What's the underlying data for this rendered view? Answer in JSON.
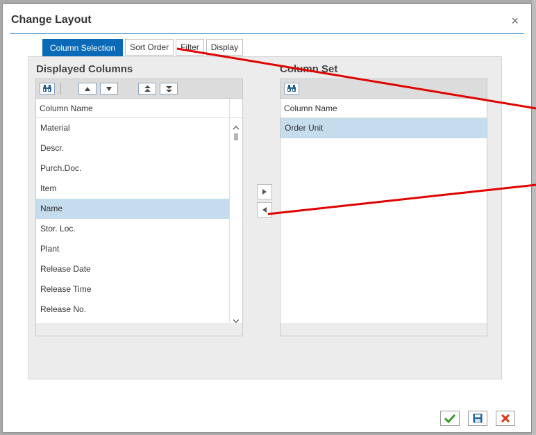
{
  "dialog": {
    "title": "Change Layout",
    "close_glyph": "×"
  },
  "tabs": [
    {
      "label": "Column Selection",
      "active": true
    },
    {
      "label": "Sort Order",
      "active": false
    },
    {
      "label": "Filter",
      "active": false
    },
    {
      "label": "Display",
      "active": false
    }
  ],
  "displayed": {
    "title": "Displayed Columns",
    "column_header": "Column Name",
    "toolbar_icons": [
      "binoculars-icon",
      "move-up-icon",
      "move-down-icon",
      "move-top-icon",
      "move-bottom-icon"
    ],
    "rows": [
      {
        "label": "Material",
        "selected": false
      },
      {
        "label": "Descr.",
        "selected": false
      },
      {
        "label": "Purch.Doc.",
        "selected": false
      },
      {
        "label": "Item",
        "selected": false
      },
      {
        "label": "Name",
        "selected": true
      },
      {
        "label": "Stor. Loc.",
        "selected": false
      },
      {
        "label": "Plant",
        "selected": false
      },
      {
        "label": "Release Date",
        "selected": false
      },
      {
        "label": "Release Time",
        "selected": false
      },
      {
        "label": "Release No.",
        "selected": false
      }
    ]
  },
  "column_set": {
    "title": "Column Set",
    "column_header": "Column Name",
    "rows": [
      {
        "label": "Order Unit",
        "selected": true
      }
    ]
  },
  "transfer": {
    "right_icon": "arrow-right-icon",
    "left_icon": "arrow-left-icon"
  },
  "footer": {
    "icons": [
      "checkmark-icon",
      "save-icon",
      "cancel-icon"
    ]
  },
  "colors": {
    "accent": "#0a6ab8",
    "selection": "#c4dcec",
    "annotation": "#e00000",
    "ok_green": "#3a9a2a",
    "cancel_red": "#d23c1c"
  }
}
